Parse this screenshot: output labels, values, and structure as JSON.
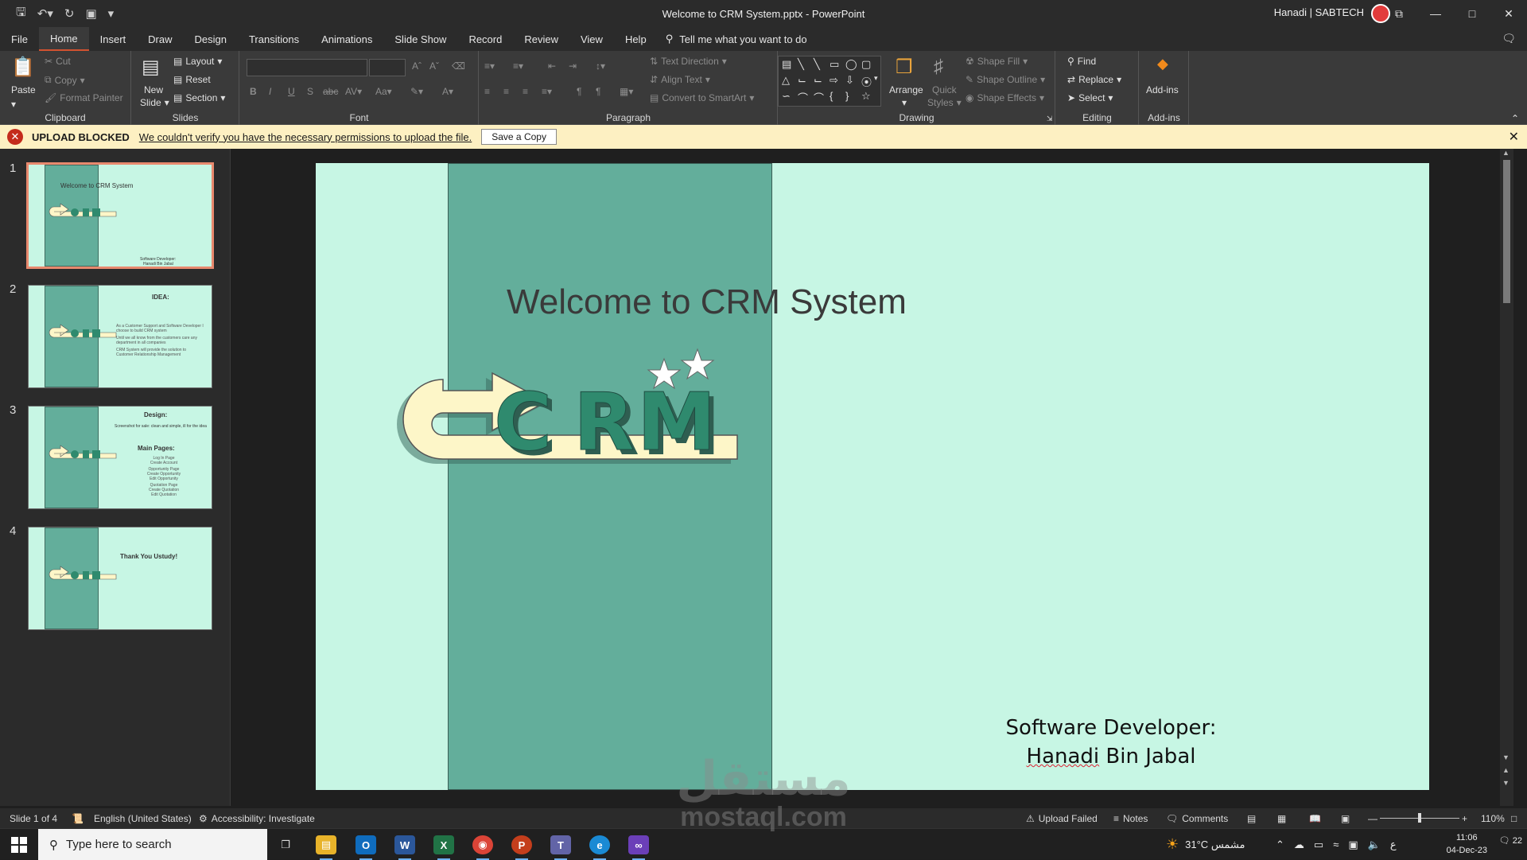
{
  "window": {
    "title": "Welcome to CRM System.pptx  -  PowerPoint",
    "user": "Hanadi | SABTECH",
    "controls": [
      "⧉",
      "—",
      "□",
      "✕"
    ]
  },
  "ribbon_tabs": [
    "File",
    "Home",
    "Insert",
    "Draw",
    "Design",
    "Transitions",
    "Animations",
    "Slide Show",
    "Record",
    "Review",
    "View",
    "Help"
  ],
  "active_tab": "Home",
  "tell_me": "Tell me what you want to do",
  "clipboard": {
    "label": "Clipboard",
    "paste": "Paste",
    "cut": "Cut",
    "copy": "Copy",
    "format_painter": "Format Painter"
  },
  "slides_group": {
    "label": "Slides",
    "new_slide_1": "New",
    "new_slide_2": "Slide",
    "layout": "Layout",
    "reset": "Reset",
    "section": "Section"
  },
  "font_group": {
    "label": "Font"
  },
  "paragraph_group": {
    "label": "Paragraph",
    "text_direction": "Text Direction",
    "align_text": "Align Text",
    "smartart": "Convert to SmartArt"
  },
  "drawing_group": {
    "label": "Drawing",
    "arrange": "Arrange",
    "quick_styles_1": "Quick",
    "quick_styles_2": "Styles",
    "shape_fill": "Shape Fill",
    "shape_outline": "Shape Outline",
    "shape_effects": "Shape Effects"
  },
  "editing_group": {
    "label": "Editing",
    "find": "Find",
    "replace": "Replace",
    "select": "Select"
  },
  "addins_group": {
    "label": "Add-ins",
    "addins": "Add-ins"
  },
  "banner": {
    "title": "UPLOAD BLOCKED",
    "message": "We couldn't verify you have the necessary permissions to upload the file.",
    "button": "Save a Copy"
  },
  "thumbnails": [
    {
      "num": "1",
      "title": "Welcome to CRM System",
      "footer1": "Software Developer:",
      "footer2": "Hanadi Bin Jabal"
    },
    {
      "num": "2",
      "title": "IDEA:",
      "bullets": [
        "As a Customer Support and Software Developer I choose to build CRM system",
        "Until we all know from the customers care any department in all companies",
        "CRM System will provide the solution to Customer Relationship Management"
      ]
    },
    {
      "num": "3",
      "title": "Design:",
      "subtitle": "Screenshot for sale: clean and simple, ill for the idea",
      "heading": "Main Pages:",
      "items": [
        "Log In Page",
        "Create Account",
        "Opportunity Page",
        "Create Opportunity",
        "Edit Opportunity",
        "Quotation Page",
        "Create Quotation",
        "Edit Quotation"
      ]
    },
    {
      "num": "4",
      "title": "Thank You Ustudy!"
    }
  ],
  "slide": {
    "title": "Welcome to CRM System",
    "author_label": "Software Developer:",
    "author_first": "Hanadi",
    "author_space": " ",
    "author_last": "Bin Jabal",
    "logo": {
      "letters": [
        "C",
        "R",
        "M"
      ],
      "band_color": "#63ae9b",
      "bg_color": "#c7f6e4",
      "arrow_color": "#fdf6c8",
      "letter_color": "#2f8a6e"
    }
  },
  "status": {
    "slide": "Slide 1 of 4",
    "language": "English (United States)",
    "accessibility": "Accessibility: Investigate",
    "upload": "Upload Failed",
    "notes": "Notes",
    "comments": "Comments",
    "zoom": "110%",
    "zoom_minus": "—",
    "zoom_plus": "+"
  },
  "taskbar": {
    "search_placeholder": "Type here to search",
    "weather": "31°C  مشمس",
    "lang": "ع",
    "time": "11:06",
    "date": "04-Dec-23",
    "notifications": "22",
    "apps": [
      {
        "name": "task-view",
        "glyph": "❐",
        "color": "#202020"
      },
      {
        "name": "file-explorer",
        "glyph": "▤",
        "color": "#e8b32a"
      },
      {
        "name": "outlook",
        "glyph": "O",
        "color": "#0f6cbd"
      },
      {
        "name": "word",
        "glyph": "W",
        "color": "#2b579a"
      },
      {
        "name": "excel",
        "glyph": "X",
        "color": "#217346"
      },
      {
        "name": "chrome",
        "glyph": "◉",
        "color": "#db4437"
      },
      {
        "name": "powerpoint",
        "glyph": "P",
        "color": "#c43e1c"
      },
      {
        "name": "teams",
        "glyph": "T",
        "color": "#6264a7"
      },
      {
        "name": "edge",
        "glyph": "e",
        "color": "#1a8ad4"
      },
      {
        "name": "visual-studio",
        "glyph": "∞",
        "color": "#6b3fb8"
      }
    ]
  },
  "watermark": {
    "arabic": "مستقل",
    "latin": "mostaql.com"
  }
}
